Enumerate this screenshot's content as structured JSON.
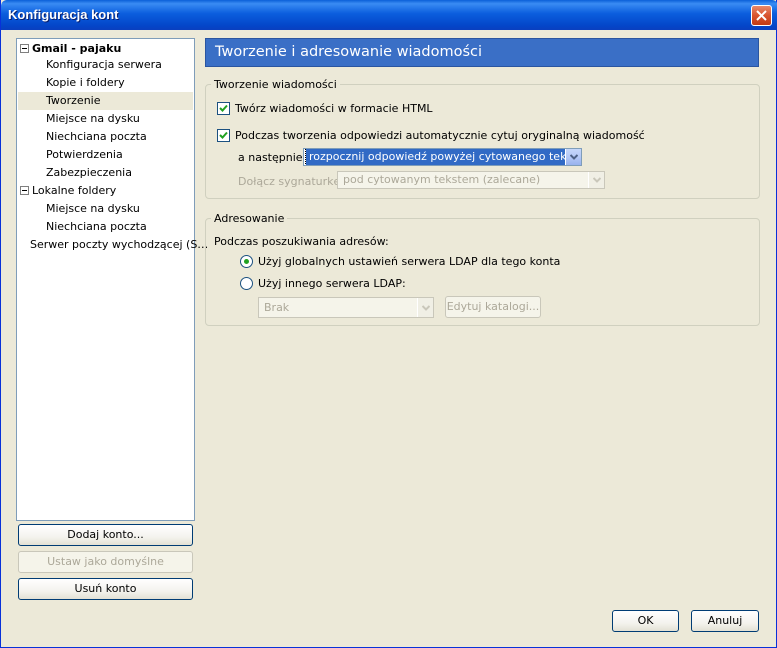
{
  "window": {
    "title": "Konfiguracja kont"
  },
  "tree": {
    "items": [
      {
        "label": "Gmail - pajaku",
        "level": 0,
        "expandable": true,
        "bold": true
      },
      {
        "label": "Konfiguracja serwera",
        "level": 1
      },
      {
        "label": "Kopie i foldery",
        "level": 1
      },
      {
        "label": "Tworzenie",
        "level": 1,
        "selected": true
      },
      {
        "label": "Miejsce na dysku",
        "level": 1
      },
      {
        "label": "Niechciana poczta",
        "level": 1
      },
      {
        "label": "Potwierdzenia",
        "level": 1
      },
      {
        "label": "Zabezpieczenia",
        "level": 1
      },
      {
        "label": "Lokalne foldery",
        "level": 0,
        "expandable": true
      },
      {
        "label": "Miejsce na dysku",
        "level": 1
      },
      {
        "label": "Niechciana poczta",
        "level": 1
      },
      {
        "label": "Serwer poczty wychodzącej (S…",
        "level": 0
      }
    ]
  },
  "left_buttons": {
    "add_account": "Dodaj konto...",
    "set_default": "Ustaw jako domyślne",
    "remove_account": "Usuń konto"
  },
  "panel": {
    "header": "Tworzenie i adresowanie wiadomości",
    "composition": {
      "legend": "Tworzenie wiadomości",
      "html_checkbox_label": "Twórz wiadomości w formacie HTML",
      "html_checked": true,
      "quote_checkbox_label": "Podczas tworzenia odpowiedzi automatycznie cytuj oryginalną wiadomość",
      "quote_checked": true,
      "then_label": "a następnie",
      "then_select_value": "rozpocznij odpowiedź powyżej cytowanego tekstu",
      "signature_label": "Dołącz sygnaturkę",
      "signature_select_value": "pod cytowanym tekstem (zalecane)"
    },
    "addressing": {
      "legend": "Adresowanie",
      "lookup_label": "Podczas poszukiwania adresów:",
      "radio_global": "Użyj globalnych ustawień serwera LDAP dla tego konta",
      "radio_other": "Użyj innego serwera LDAP:",
      "selected_radio": "global",
      "ldap_select_value": "Brak",
      "edit_directories_button": "Edytuj katalogi..."
    }
  },
  "footer": {
    "ok": "OK",
    "cancel": "Anuluj"
  },
  "colors": {
    "title_bar": "#0b5ede",
    "header_bg": "#3a6fc6",
    "window_bg": "#ece9d8",
    "radio_dot": "#21a121"
  }
}
